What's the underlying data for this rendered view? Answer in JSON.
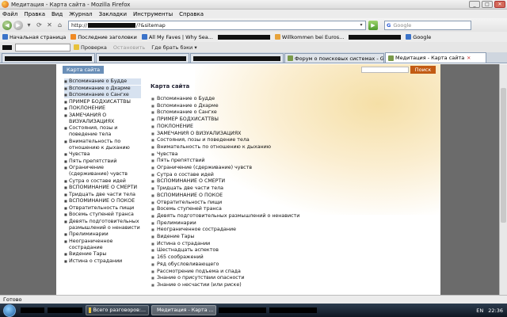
{
  "window": {
    "title": "Медитация - Карта сайта - Mozilla Firefox"
  },
  "menu": [
    "Файл",
    "Правка",
    "Вид",
    "Журнал",
    "Закладки",
    "Инструменты",
    "Справка"
  ],
  "nav": {
    "url_prefix": "http://",
    "url_suffix": "/?&sitemap",
    "search_placeholder": "Google",
    "search_engine_glyph": "G"
  },
  "bookmarks": [
    {
      "label": "Начальная страница",
      "icon": "blue"
    },
    {
      "label": "Последние заголовки",
      "icon": "rss"
    },
    {
      "label": "All My Faves | Why Sea...",
      "icon": "blue"
    },
    {
      "label": "Willkommen bei Euros...",
      "icon": "orange"
    },
    {
      "label": "Google",
      "icon": "blue"
    }
  ],
  "toolbar2": {
    "check": "Проверка",
    "stop": "Остановить",
    "where": "Где брать бэки ▾"
  },
  "tabs": [
    {
      "label": "",
      "redacted": true
    },
    {
      "label": "",
      "redacted": true
    },
    {
      "label": "",
      "redacted": true
    },
    {
      "label": "Форум о поисковых системах - Googl...",
      "redacted": false
    },
    {
      "label": "Медитация - Карта сайта",
      "redacted": false,
      "active": true
    }
  ],
  "page": {
    "header_tag": "Карта сайта",
    "search_button": "Поиск",
    "sitemap_title": "Карта сайта",
    "leftnav": [
      "Вспоминание о Будде",
      "Вспоминание о Дхарме",
      "Вспоминание о Сангхе",
      "ПРИМЕР БОДХИСАТТВЫ",
      "ПОКЛОНЕНИЕ",
      "ЗАМЕЧАНИЯ О ВИЗУАЛИЗАЦИЯХ",
      "Состояния, позы и поведение тела",
      "Внимательность по отношению к дыханию",
      "Чувства",
      "Пять препятствий",
      "Ограничение (сдерживание) чувств",
      "Сутра о составе идей",
      "ВСПОМИНАНИЕ О СМЕРТИ",
      "Тридцать две части тела",
      "ВСПОМИНАНИЕ О ПОКОЕ",
      "Отвратительность пищи",
      "Восемь ступеней транса",
      "Девять подготовительных размышлений о ненависти",
      "Прелиминарии",
      "Неограниченное сострадание",
      "Видение Тары",
      "Истина о страдании"
    ],
    "sitemap": [
      "Вспоминание о Будде",
      "Вспоминание о Дхарме",
      "Вспоминание о Сангхе",
      "ПРИМЕР БОДХИСАТТВЫ",
      "ПОКЛОНЕНИЕ",
      "ЗАМЕЧАНИЯ О ВИЗУАЛИЗАЦИЯХ",
      "Состояния, позы и поведение тела",
      "Внимательность по отношению к дыханию",
      "Чувства",
      "Пять препятствий",
      "Ограничение (сдерживание) чувств",
      "Сутра о составе идей",
      "ВСПОМИНАНИЕ О СМЕРТИ",
      "Тридцать две части тела",
      "ВСПОМИНАНИЕ О ПОКОЕ",
      "Отвратительность пищи",
      "Восемь ступеней транса",
      "Девять подготовительных размышлений о ненависти",
      "Прелиминарии",
      "Неограниченное сострадание",
      "Видение Тары",
      "Истина о страдании",
      "Шестнадцать аспектов",
      "165 соображений",
      "Ряд обусловливающего",
      "Рассмотрение подъема и спада",
      "Знание о присутствии опасности",
      "Знание о несчастии (или риске)"
    ]
  },
  "status": "Готово",
  "taskbar": {
    "items": [
      {
        "label": "Всего разговоров:...",
        "active": false
      },
      {
        "label": "Медитация - Карта ...",
        "active": true
      }
    ],
    "lang": "EN",
    "time": "22:36"
  },
  "colors": {
    "accent_blue": "#6a8fb8",
    "search_btn": "#c25b14",
    "page_glow": "#f5dfa6"
  }
}
